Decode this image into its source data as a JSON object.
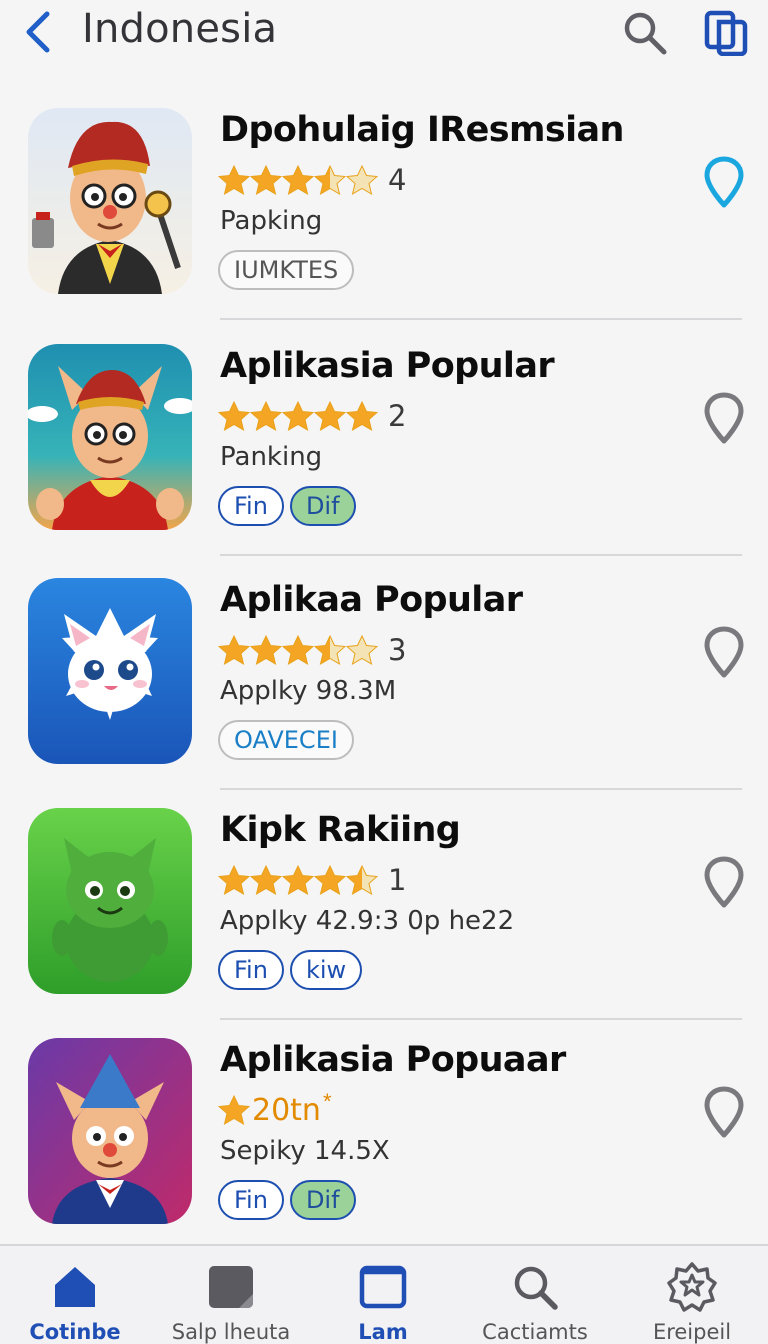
{
  "header": {
    "title": "Indonesia"
  },
  "apps": [
    {
      "name": "Dpohulaig IResmsian",
      "stars": 3.5,
      "rating": "4",
      "subtitle": "Papking",
      "tags": [
        "IUMKTES"
      ],
      "pin_color": "#1aa7e0"
    },
    {
      "name": "Aplikasia Popular",
      "stars": 5,
      "rating": "2",
      "subtitle": "Panking",
      "tags": [
        "Fin",
        "Dif"
      ],
      "pin_color": "#7a7a7e"
    },
    {
      "name": "Aplikaa Popular",
      "stars": 3.5,
      "rating": "3",
      "subtitle": "Applky 98.3M",
      "tags": [
        "OAVECEI"
      ],
      "pin_color": "#7a7a7e"
    },
    {
      "name": "Kipk Rakiing",
      "stars": 4.5,
      "rating": "1",
      "subtitle": "Applky 42.9:3 0p he22",
      "tags": [
        "Fin",
        "kiw"
      ],
      "pin_color": "#7a7a7e"
    },
    {
      "name": "Aplikasia Popuaar",
      "rating_text": "20tn",
      "subtitle": "Sepiky 14.5X",
      "tags": [
        "Fin",
        "Dif"
      ],
      "pin_color": "#7a7a7e"
    }
  ],
  "bottom_nav": [
    {
      "label": "Cotinbe",
      "icon": "home-icon",
      "active": true
    },
    {
      "label": "Salp lheuta",
      "icon": "square-icon",
      "active": false
    },
    {
      "label": "Lam",
      "icon": "window-icon",
      "active": false
    },
    {
      "label": "Cactiamts",
      "icon": "search-icon",
      "active": false
    },
    {
      "label": "Ereipeil",
      "icon": "badge-icon",
      "active": false
    }
  ],
  "colors": {
    "accent": "#1f4fb5",
    "star": "#f5a524",
    "star_empty": "#f3e3b5"
  }
}
